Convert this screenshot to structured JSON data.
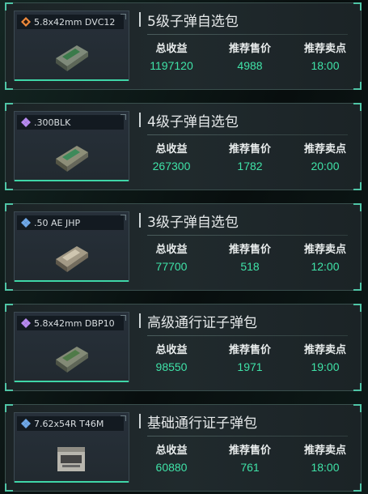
{
  "labels": {
    "total_income": "总收益",
    "recommended_price": "推荐售价",
    "recommended_time": "推荐卖点"
  },
  "colors": {
    "accent_green": "#3fe3a8",
    "rarity_orange": "#f08a3c",
    "rarity_purple": "#b78af0",
    "rarity_blue": "#6fa8e8"
  },
  "cards": [
    {
      "title": "5级子弹自选包",
      "item_name": "5.8x42mm DVC12",
      "rarity_icon": "orange-diamond-icon",
      "total_income": "1197120",
      "recommended_price": "4988",
      "recommended_time": "18:00"
    },
    {
      "title": "4级子弹自选包",
      "item_name": ".300BLK",
      "rarity_icon": "purple-diamond-icon",
      "total_income": "267300",
      "recommended_price": "1782",
      "recommended_time": "20:00"
    },
    {
      "title": "3级子弹自选包",
      "item_name": ".50 AE JHP",
      "rarity_icon": "blue-diamond-icon",
      "total_income": "77700",
      "recommended_price": "518",
      "recommended_time": "12:00"
    },
    {
      "title": "高级通行证子弹包",
      "item_name": "5.8x42mm DBP10",
      "rarity_icon": "purple-diamond-icon",
      "total_income": "98550",
      "recommended_price": "1971",
      "recommended_time": "19:00"
    },
    {
      "title": "基础通行证子弹包",
      "item_name": "7.62x54R T46M",
      "rarity_icon": "blue-diamond-icon",
      "total_income": "60880",
      "recommended_price": "761",
      "recommended_time": "18:00"
    }
  ]
}
